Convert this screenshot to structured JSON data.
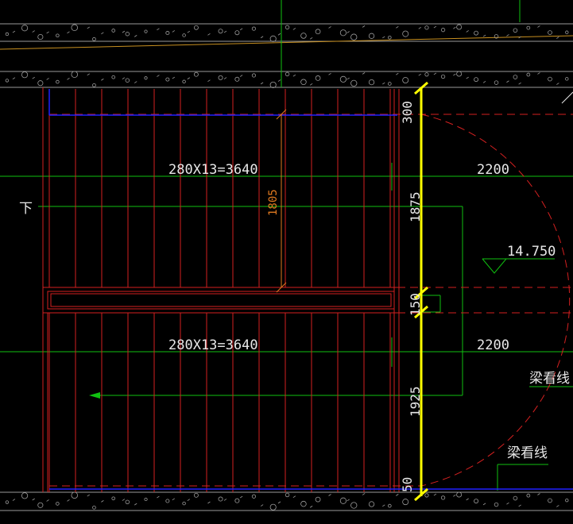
{
  "drawing": {
    "flight_upper_label": "280X13=3640",
    "flight_lower_label": "280X13=3640",
    "landing_width_upper": "2200",
    "landing_width_lower": "2200",
    "elevation": "14.750",
    "down_arrow_label": "下",
    "beam_line_label_1": "梁看线",
    "beam_line_label_2": "梁看线",
    "dim_300": "300",
    "dim_1875": "1875",
    "dim_150": "150",
    "dim_1925": "1925",
    "dim_50": "50",
    "dim_1805": "1805"
  },
  "colors": {
    "background": "#000000",
    "stair_lines": "#d42020",
    "axis_green": "#10c010",
    "highlight_yellow": "#ffff00",
    "slab_grey": "#9a9a9a",
    "blue_line": "#2020ff",
    "orange_dim": "#e07a20"
  }
}
